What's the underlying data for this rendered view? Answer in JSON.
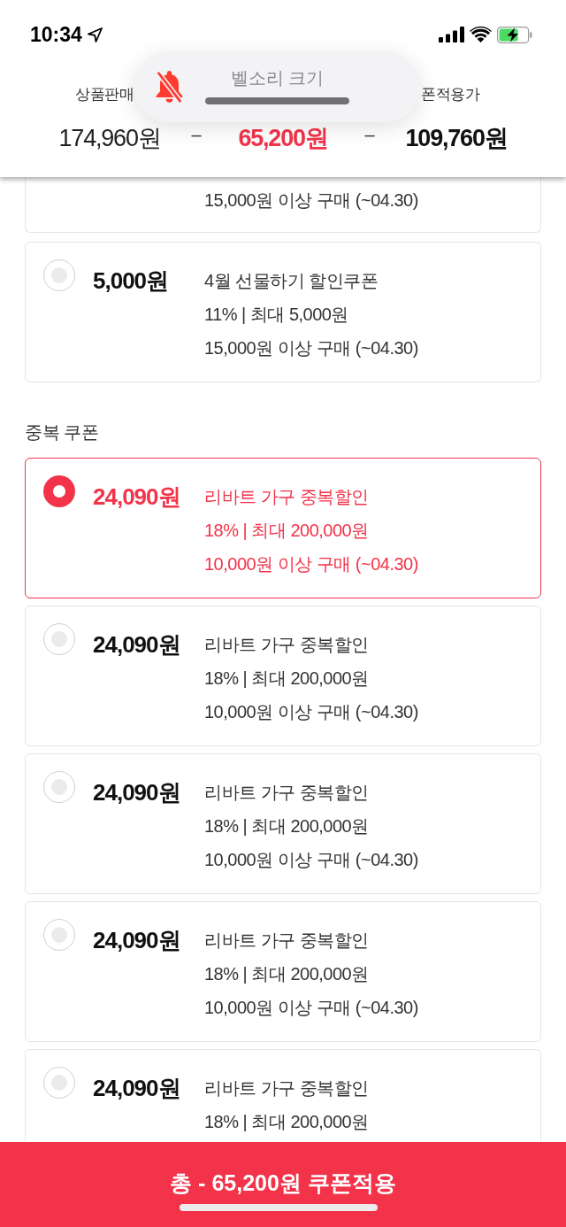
{
  "status_bar": {
    "time": "10:34"
  },
  "price_summary": {
    "items": [
      {
        "kind": "price",
        "label": "상품판매",
        "value": "174,960원"
      },
      {
        "kind": "operator",
        "symbol": "–"
      },
      {
        "kind": "discount",
        "value": "65,200원"
      },
      {
        "kind": "operator",
        "symbol": "–"
      },
      {
        "kind": "total",
        "label": "폰적용가",
        "value": "109,760원"
      }
    ]
  },
  "ringer_hud": {
    "title": "벨소리 크기",
    "muted": true,
    "level": 1
  },
  "coupon_sections": [
    {
      "cards": [
        {
          "kind": "clipped",
          "condition": "15,000원 이상 구매 (~04.30)",
          "selected": false
        },
        {
          "kind": "full",
          "amount": "5,000원",
          "title": "4월 선물하기 할인쿠폰",
          "rate": "11% | 최대 5,000원",
          "condition": "15,000원 이상 구매 (~04.30)",
          "selected": false
        }
      ]
    },
    {
      "heading": "중복 쿠폰",
      "cards": [
        {
          "kind": "full",
          "amount": "24,090원",
          "title": "리바트 가구 중복할인",
          "rate": "18% | 최대 200,000원",
          "condition": "10,000원 이상 구매 (~04.30)",
          "selected": true
        },
        {
          "kind": "full",
          "amount": "24,090원",
          "title": "리바트 가구 중복할인",
          "rate": "18% | 최대 200,000원",
          "condition": "10,000원 이상 구매 (~04.30)",
          "selected": false
        },
        {
          "kind": "full",
          "amount": "24,090원",
          "title": "리바트 가구 중복할인",
          "rate": "18% | 최대 200,000원",
          "condition": "10,000원 이상 구매 (~04.30)",
          "selected": false
        },
        {
          "kind": "full",
          "amount": "24,090원",
          "title": "리바트 가구 중복할인",
          "rate": "18% | 최대 200,000원",
          "condition": "10,000원 이상 구매 (~04.30)",
          "selected": false
        },
        {
          "kind": "full",
          "amount": "24,090원",
          "title": "리바트 가구 중복할인",
          "rate": "18% | 최대 200,000원",
          "selected": false
        }
      ]
    }
  ],
  "apply_button": {
    "label": "총 - 65,200원 쿠폰적용"
  }
}
